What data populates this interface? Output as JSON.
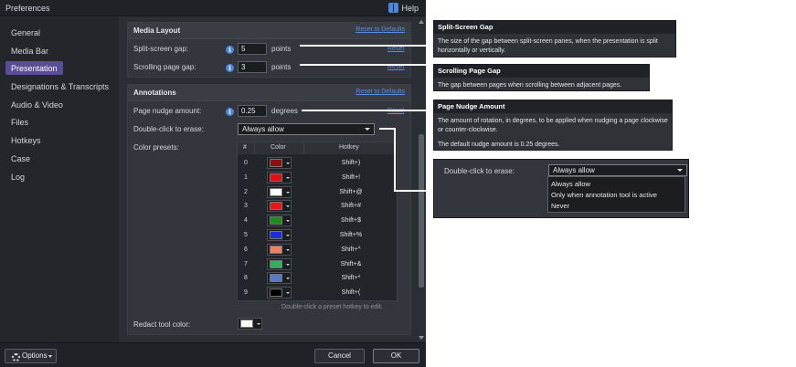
{
  "window": {
    "title": "Preferences",
    "help_label": "Help"
  },
  "sidebar": {
    "items": [
      {
        "label": "General"
      },
      {
        "label": "Media Bar"
      },
      {
        "label": "Presentation",
        "active": true
      },
      {
        "label": "Designations & Transcripts"
      },
      {
        "label": "Audio & Video"
      },
      {
        "label": "Files"
      },
      {
        "label": "Hotkeys"
      },
      {
        "label": "Case"
      },
      {
        "label": "Log"
      }
    ]
  },
  "media_layout": {
    "title": "Media Layout",
    "reset_label": "Reset to Defaults",
    "split_gap": {
      "label": "Split-screen gap:",
      "value": "5",
      "unit": "points",
      "reset": "Reset"
    },
    "scroll_gap": {
      "label": "Scrolling page gap:",
      "value": "3",
      "unit": "points",
      "reset": "Reset"
    }
  },
  "annotations": {
    "title": "Annotations",
    "reset_label": "Reset to Defaults",
    "nudge": {
      "label": "Page nudge amount:",
      "value": "0.25",
      "unit": "degrees",
      "reset": "Reset"
    },
    "erase": {
      "label": "Double-click to erase:",
      "value": "Always allow"
    },
    "presets": {
      "label": "Color presets:",
      "headers": [
        "#",
        "Color",
        "Hotkey"
      ],
      "rows": [
        {
          "num": "0",
          "color": "#8b1010",
          "hotkey": "Shift+)"
        },
        {
          "num": "1",
          "color": "#e01010",
          "hotkey": "Shift+!"
        },
        {
          "num": "2",
          "color": "#ffffff",
          "hotkey": "Shift+@"
        },
        {
          "num": "3",
          "color": "#e81818",
          "hotkey": "Shift+#"
        },
        {
          "num": "4",
          "color": "#1f8a1f",
          "hotkey": "Shift+$"
        },
        {
          "num": "5",
          "color": "#1a2ed8",
          "hotkey": "Shift+%"
        },
        {
          "num": "6",
          "color": "#f08060",
          "hotkey": "Shift+^"
        },
        {
          "num": "7",
          "color": "#30b060",
          "hotkey": "Shift+&"
        },
        {
          "num": "8",
          "color": "#5a78c8",
          "hotkey": "Shift+*"
        },
        {
          "num": "9",
          "color": "#000000",
          "hotkey": "Shift+("
        }
      ],
      "hint": "Double-click a preset hotkey to edit."
    },
    "redact": {
      "label": "Redact tool color:",
      "color": "#ffffff"
    }
  },
  "footer": {
    "options_label": "Options",
    "cancel_label": "Cancel",
    "ok_label": "OK"
  },
  "callouts": {
    "split": {
      "title": "Split-Screen Gap",
      "body": "The size of the gap between split-screen panes, when the presentation is split horizontally or vertically."
    },
    "scroll": {
      "title": "Scrolling Page Gap",
      "body": "The gap between pages when scrolling between adjacent pages."
    },
    "nudge": {
      "title": "Page Nudge Amount",
      "body": "The amount of rotation, in degrees, to be applied when nudging a page clockwise or counter-clockwise.",
      "body2": "The default nudge amount is 0.25 degrees."
    },
    "erase": {
      "label": "Double-click to erase:",
      "value": "Always allow",
      "options": [
        "Always allow",
        "Only when annotation tool is active",
        "Never"
      ]
    }
  },
  "colors": {
    "accent": "#5a4c98",
    "link": "#5b8fe0",
    "info": "#4c87dd"
  }
}
